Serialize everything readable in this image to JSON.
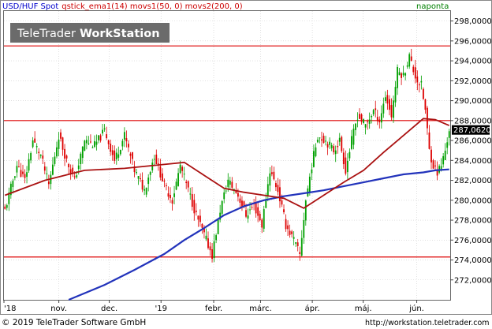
{
  "header": {
    "instrument": "USD/HUF Spot",
    "indicators": "qstick_ema1(14) movs1(50, 0) movs2(200, 0)",
    "period": "naponta",
    "watermark_brand": "TeleTrader",
    "watermark_product": "WorkStation"
  },
  "footer": {
    "copyright": "© 2019 TeleTrader Software GmbH",
    "url": "http://workstation.teletrader.com"
  },
  "colors": {
    "instrument": "#0000cc",
    "indicator_text": "#cc0000",
    "period": "#008000",
    "candle_up": "#00a000",
    "candle_down": "#dd0000",
    "ma50": "#aa1111",
    "ma200": "#2233bb",
    "hline": "#dd0000",
    "grid": "#cccccc",
    "watermark_bg": "#6b6b6b",
    "watermark_text": "#ffffff"
  },
  "chart_data": {
    "type": "candlestick",
    "ylim": [
      270.0,
      299.0
    ],
    "y_ticks": [
      272,
      274,
      276,
      278,
      280,
      282,
      284,
      286,
      288,
      290,
      292,
      294,
      296,
      298
    ],
    "y_tick_labels": [
      "272,0000",
      "274,0000",
      "276,0000",
      "278,0000",
      "280,0000",
      "282,0000",
      "284,0000",
      "286,0000",
      "288,0000",
      "290,0000",
      "292,0000",
      "294,0000",
      "296,0000",
      "298,0000"
    ],
    "x_tick_labels": [
      "'18",
      "nov.",
      "dec.",
      "'19",
      "febr.",
      "márc.",
      "ápr.",
      "máj.",
      "jún."
    ],
    "x_ticks_fraction": [
      0.0,
      0.123,
      0.236,
      0.352,
      0.47,
      0.575,
      0.691,
      0.805,
      0.925
    ],
    "last_price_label": "287,0620",
    "last_price": 287.062,
    "horizontal_lines": [
      295.5,
      288.0,
      274.3
    ],
    "grid": true,
    "legend": "none",
    "anchors": [
      [
        0,
        279.0
      ],
      [
        6,
        283.5
      ],
      [
        10,
        282.0
      ],
      [
        14,
        286.0
      ],
      [
        18,
        284.5
      ],
      [
        22,
        281.5
      ],
      [
        27,
        286.5
      ],
      [
        31,
        284.0
      ],
      [
        35,
        282.0
      ],
      [
        40,
        286.0
      ],
      [
        45,
        285.5
      ],
      [
        50,
        287.0
      ],
      [
        55,
        284.0
      ],
      [
        60,
        286.5
      ],
      [
        65,
        283.0
      ],
      [
        70,
        281.0
      ],
      [
        75,
        284.5
      ],
      [
        80,
        281.5
      ],
      [
        84,
        280.0
      ],
      [
        88,
        283.5
      ],
      [
        92,
        281.0
      ],
      [
        96,
        278.5
      ],
      [
        100,
        276.5
      ],
      [
        104,
        274.5
      ],
      [
        108,
        279.0
      ],
      [
        112,
        282.0
      ],
      [
        117,
        280.5
      ],
      [
        121,
        278.5
      ],
      [
        125,
        279.5
      ],
      [
        129,
        277.5
      ],
      [
        133,
        283.0
      ],
      [
        137,
        281.0
      ],
      [
        141,
        277.5
      ],
      [
        145,
        276.0
      ],
      [
        148,
        274.5
      ],
      [
        151,
        280.0
      ],
      [
        154,
        283.5
      ],
      [
        157,
        286.5
      ],
      [
        161,
        286.0
      ],
      [
        165,
        285.0
      ],
      [
        168,
        286.0
      ],
      [
        171,
        283.0
      ],
      [
        174,
        286.0
      ],
      [
        177,
        288.5
      ],
      [
        181,
        287.5
      ],
      [
        185,
        289.0
      ],
      [
        188,
        288.0
      ],
      [
        191,
        290.5
      ],
      [
        194,
        288.5
      ],
      [
        197,
        293.0
      ],
      [
        200,
        292.5
      ],
      [
        203,
        294.5
      ],
      [
        205,
        293.0
      ],
      [
        207,
        292.0
      ],
      [
        209,
        291.5
      ],
      [
        211,
        289.0
      ],
      [
        213,
        285.0
      ],
      [
        215,
        283.5
      ],
      [
        217,
        282.8
      ],
      [
        219,
        283.5
      ],
      [
        221,
        285.0
      ],
      [
        223,
        287.1
      ]
    ],
    "ma50": [
      [
        0,
        280.5
      ],
      [
        20,
        282.0
      ],
      [
        40,
        283.0
      ],
      [
        60,
        283.2
      ],
      [
        80,
        283.6
      ],
      [
        90,
        283.8
      ],
      [
        100,
        282.5
      ],
      [
        110,
        281.2
      ],
      [
        120,
        280.8
      ],
      [
        130,
        280.5
      ],
      [
        140,
        280.2
      ],
      [
        150,
        279.2
      ],
      [
        160,
        280.5
      ],
      [
        170,
        281.8
      ],
      [
        180,
        283.0
      ],
      [
        190,
        284.8
      ],
      [
        200,
        286.5
      ],
      [
        210,
        288.2
      ],
      [
        216,
        288.1
      ],
      [
        223,
        287.5
      ]
    ],
    "ma200": [
      [
        32,
        270.0
      ],
      [
        50,
        271.5
      ],
      [
        65,
        273.0
      ],
      [
        80,
        274.6
      ],
      [
        90,
        276.0
      ],
      [
        100,
        277.2
      ],
      [
        110,
        278.5
      ],
      [
        120,
        279.4
      ],
      [
        130,
        280.0
      ],
      [
        140,
        280.4
      ],
      [
        150,
        280.7
      ],
      [
        160,
        281.0
      ],
      [
        170,
        281.4
      ],
      [
        180,
        281.8
      ],
      [
        190,
        282.2
      ],
      [
        200,
        282.6
      ],
      [
        210,
        282.8
      ],
      [
        216,
        283.0
      ],
      [
        223,
        283.1
      ]
    ]
  }
}
